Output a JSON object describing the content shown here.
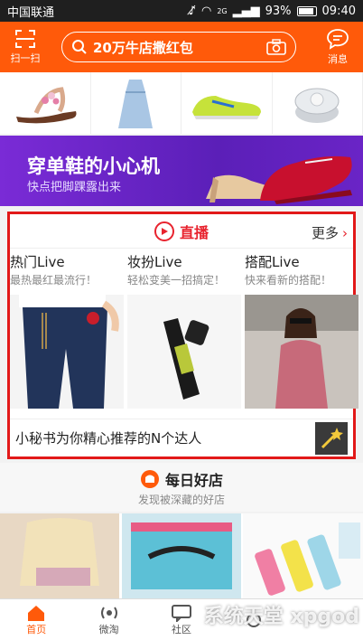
{
  "status_bar": {
    "carrier": "中国联通",
    "network": "2G",
    "battery": "93%",
    "time": "09:40"
  },
  "header": {
    "scan_label": "扫一扫",
    "search_placeholder": "20万牛店撒红包",
    "messages_label": "消息"
  },
  "banner": {
    "title": "穿单鞋的小心机",
    "subtitle": "快点把脚踝露出来"
  },
  "live": {
    "title": "直播",
    "more_label": "更多",
    "columns": [
      {
        "title": "热门Live",
        "subtitle": "最热最红最流行！"
      },
      {
        "title": "妆扮Live",
        "subtitle": "轻松变美一招搞定！"
      },
      {
        "title": "搭配Live",
        "subtitle": "快来看新的搭配！"
      }
    ],
    "footer": "小秘书为你精心推荐的N个达人"
  },
  "daily_shop": {
    "title": "每日好店",
    "subtitle": "发现被深藏的好店"
  },
  "tabbar": {
    "items": [
      {
        "label": "首页"
      },
      {
        "label": "微淘"
      },
      {
        "label": "社区"
      }
    ]
  },
  "watermark": "系统天堂 xpgod",
  "colors": {
    "brand": "#ff5a0a",
    "live_accent": "#e8232e",
    "banner_purple": "#6a24c6"
  }
}
